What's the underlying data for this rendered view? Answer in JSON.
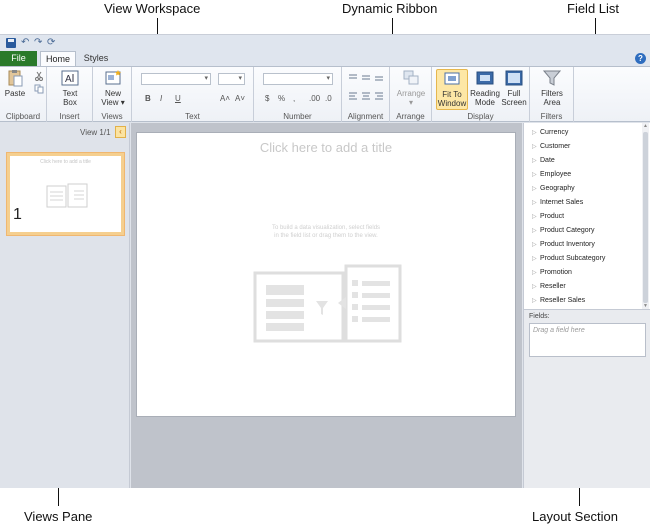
{
  "callouts": {
    "view_workspace": "View Workspace",
    "dynamic_ribbon": "Dynamic Ribbon",
    "field_list": "Field List",
    "views_pane": "Views Pane",
    "layout_section": "Layout Section"
  },
  "tabs": {
    "file": "File",
    "home": "Home",
    "styles": "Styles",
    "help": "?"
  },
  "ribbon": {
    "paste": "Paste",
    "text_box": [
      "Text",
      "Box"
    ],
    "new_view": [
      "New",
      "View ▾"
    ],
    "font_controls": {
      "bold": "B",
      "italic": "I",
      "underline": "U",
      "grow": "A˄",
      "shrink": "A˅"
    },
    "number_controls": {
      "currency": "$",
      "percent": "%",
      "comma": ",",
      "inc_dec": ".00",
      "dec_dec": ".0"
    },
    "arrange": [
      "Arrange",
      "▾"
    ],
    "fit_to_window": [
      "Fit To",
      "Window"
    ],
    "reading_mode": [
      "Reading",
      "Mode"
    ],
    "full_screen": [
      "Full",
      "Screen"
    ],
    "filters_area": [
      "Filters",
      "Area"
    ],
    "groups": {
      "clipboard": "Clipboard",
      "insert": "Insert",
      "views": "Views",
      "text": "Text",
      "number": "Number",
      "alignment": "Alignment",
      "arrange": "Arrange",
      "display": "Display",
      "filters": "Filters"
    }
  },
  "views_pane": {
    "counter": "View 1/1",
    "collapse": "‹",
    "thumb_title": "Click here to add a title",
    "thumb_number": "1"
  },
  "workspace": {
    "title_placeholder": "Click here to add a title",
    "hint_line1": "To build a data visualization, select fields",
    "hint_line2": "in the field list or drag them to the view."
  },
  "field_list": {
    "items": [
      "Currency",
      "Customer",
      "Date",
      "Employee",
      "Geography",
      "Internet Sales",
      "Product",
      "Product Category",
      "Product Inventory",
      "Product Subcategory",
      "Promotion",
      "Reseller",
      "Reseller Sales"
    ]
  },
  "layout_section": {
    "fields_label": "Fields:",
    "drop_placeholder": "Drag a field here"
  },
  "colors": {
    "file_tab": "#2a7a2a",
    "active_button": "#fde7a6",
    "thumb_border": "#f5cf8f"
  }
}
